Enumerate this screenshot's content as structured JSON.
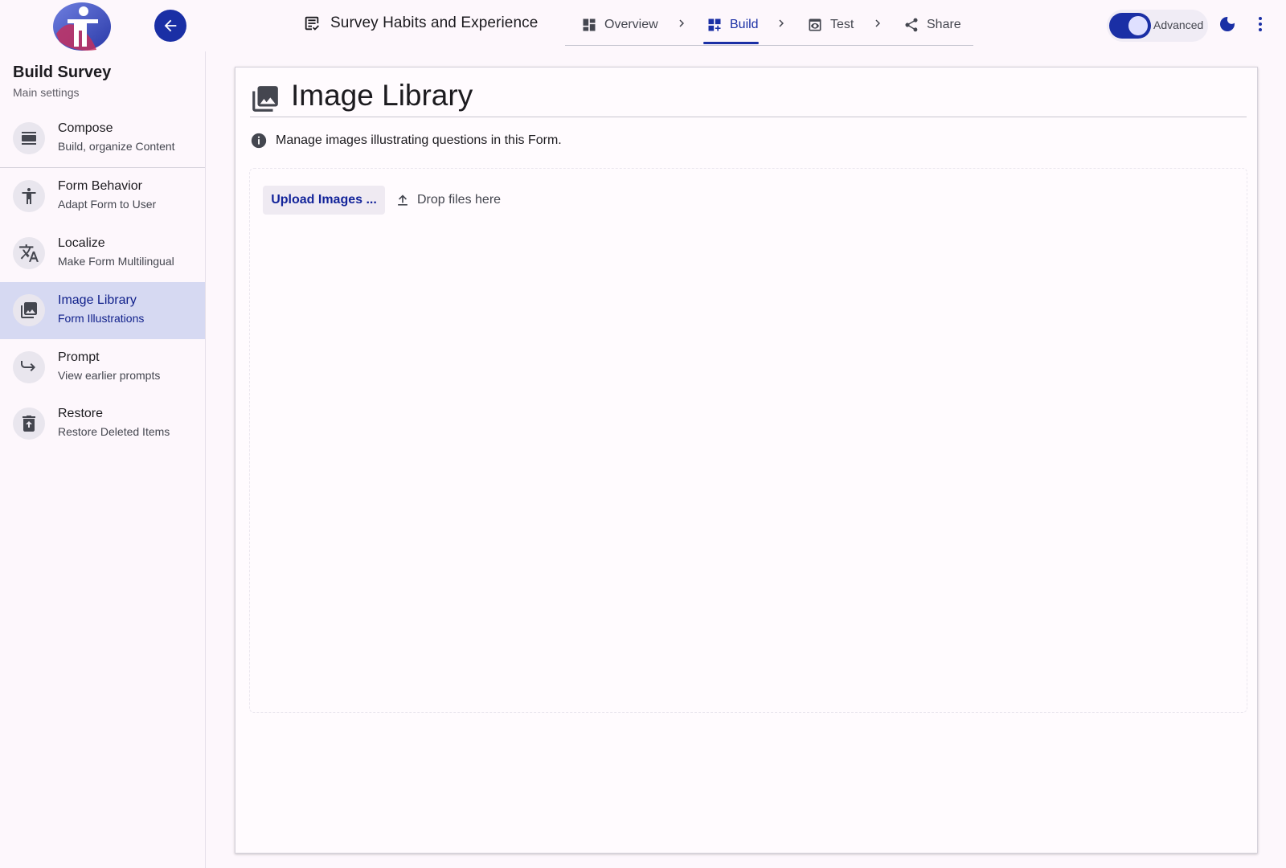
{
  "header": {
    "survey_title": "Survey Habits and Experience",
    "steps": [
      {
        "label": "Overview",
        "icon": "dashboard-icon",
        "active": false
      },
      {
        "label": "Build",
        "icon": "dashboard-add-icon",
        "active": true
      },
      {
        "label": "Test",
        "icon": "preview-icon",
        "active": false
      },
      {
        "label": "Share",
        "icon": "share-icon",
        "active": false
      }
    ],
    "advanced_label": "Advanced",
    "advanced_on": true
  },
  "sidebar": {
    "title": "Build Survey",
    "subtitle": "Main settings",
    "items": [
      {
        "label": "Compose",
        "sub": "Build, organize Content",
        "icon": "compose-icon"
      },
      {
        "label": "Form Behavior",
        "sub": "Adapt Form to User",
        "icon": "accessibility-icon"
      },
      {
        "label": "Localize",
        "sub": "Make Form Multilingual",
        "icon": "translate-icon"
      },
      {
        "label": "Image Library",
        "sub": "Form Illustrations",
        "icon": "photo-library-icon",
        "active": true
      },
      {
        "label": "Prompt",
        "sub": "View earlier prompts",
        "icon": "redo-arrow-icon"
      },
      {
        "label": "Restore",
        "sub": "Restore Deleted Items",
        "icon": "restore-trash-icon"
      }
    ]
  },
  "main": {
    "title": "Image Library",
    "info": "Manage images illustrating questions in this Form.",
    "upload_label": "Upload Images ...",
    "drop_hint": "Drop files here"
  },
  "colors": {
    "accent": "#1a2fa5",
    "active_bg": "#d6d9f2",
    "background": "#fdf7fc"
  }
}
